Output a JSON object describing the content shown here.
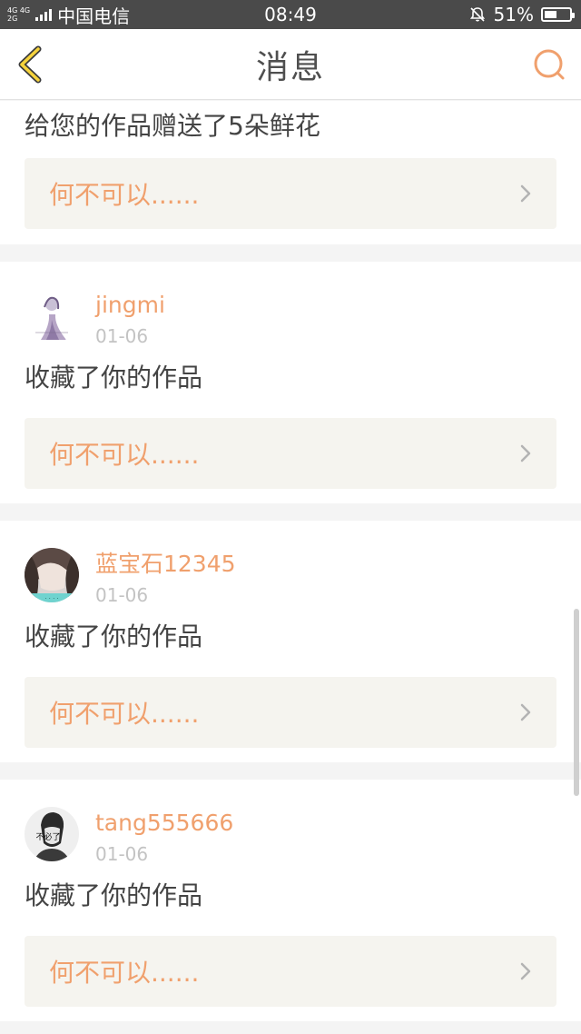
{
  "status_bar": {
    "network_top": "4G 4G",
    "network_bottom": "2G",
    "carrier": "中国电信",
    "time": "08:49",
    "battery_text": "51%",
    "battery_level": 0.51
  },
  "header": {
    "title": "消息",
    "back_icon": "chevron-left-icon",
    "search_icon": "search-icon",
    "accent_color": "#f0a06d"
  },
  "feed": {
    "first": {
      "action": "给您的作品赠送了5朵鲜花",
      "work_title": "何不可以......"
    },
    "items": [
      {
        "username": "jingmi",
        "date": "01-06",
        "action": "收藏了你的作品",
        "work_title": "何不可以......"
      },
      {
        "username": "蓝宝石12345",
        "date": "01-06",
        "action": "收藏了你的作品",
        "work_title": "何不可以......"
      },
      {
        "username": "tang555666",
        "date": "01-06",
        "action": "收藏了你的作品",
        "work_title": "何不可以......"
      }
    ]
  },
  "avatars": {
    "item3_badge_text": "不必了"
  }
}
